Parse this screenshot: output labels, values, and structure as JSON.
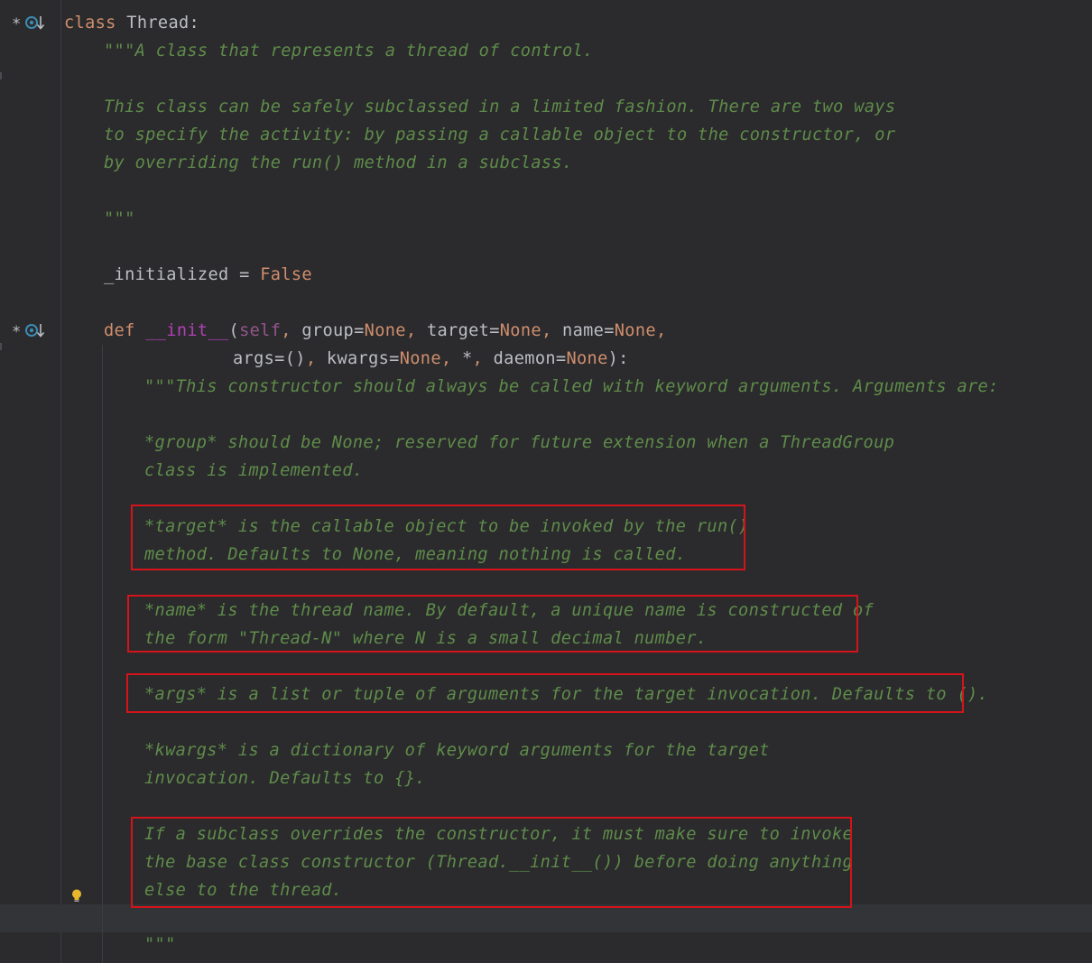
{
  "editor": {
    "lines": {
      "l1_kw": "class",
      "l1_name": "Thread:",
      "l2": "\"\"\"A class that represents a thread of control.",
      "l4": "This class can be safely subclassed in a limited fashion. There are two ways",
      "l5": "to specify the activity: by passing a callable object to the constructor, or",
      "l6": "by overriding the run() method in a subclass.",
      "l8": "\"\"\"",
      "l10_name": "_initialized",
      "l10_eq": " = ",
      "l10_val": "False",
      "l12_def": "def",
      "l12_init": "__init__",
      "l12_open": "(",
      "l12_self": "self",
      "l12_c1": ", ",
      "l12_group": "group=",
      "l12_none1": "None",
      "l12_c2": ", ",
      "l12_target": "target=",
      "l12_none2": "None",
      "l12_c3": ", ",
      "l12_name": "name=",
      "l12_none3": "None",
      "l12_c4": ",",
      "l13_args": "args=()",
      "l13_c1": ", ",
      "l13_kwargs": "kwargs=",
      "l13_none1": "None",
      "l13_c2": ", ",
      "l13_star": "*",
      "l13_c3": ", ",
      "l13_daemon": "daemon=",
      "l13_none2": "None",
      "l13_close": "):",
      "l14": "\"\"\"This constructor should always be called with keyword arguments. Arguments are:",
      "l16": "*group* should be None; reserved for future extension when a ThreadGroup",
      "l17": "class is implemented.",
      "l19": "*target* is the callable object to be invoked by the run()",
      "l20": "method. Defaults to None, meaning nothing is called.",
      "l22": "*name* is the thread name. By default, a unique name is constructed of",
      "l23": "the form \"Thread-N\" where N is a small decimal number.",
      "l25": "*args* is a list or tuple of arguments for the target invocation. Defaults to ().",
      "l27": "*kwargs* is a dictionary of keyword arguments for the target",
      "l28": "invocation. Defaults to {}.",
      "l30": "If a subclass overrides the constructor, it must make sure to invoke",
      "l31": "the base class constructor (Thread.__init__()) before doing anything",
      "l32": "else to the thread.",
      "l34": "\"\"\""
    },
    "gutter_icons": [
      "override-marker-icon",
      "override-marker-icon",
      "lightbulb-icon"
    ],
    "colors": {
      "background": "#2b2b2d",
      "keyword": "#cf8e6d",
      "docstring": "#5f8c4a",
      "dunder": "#b33fb8",
      "self": "#94558d",
      "highlight_box": "#d4131a"
    }
  }
}
